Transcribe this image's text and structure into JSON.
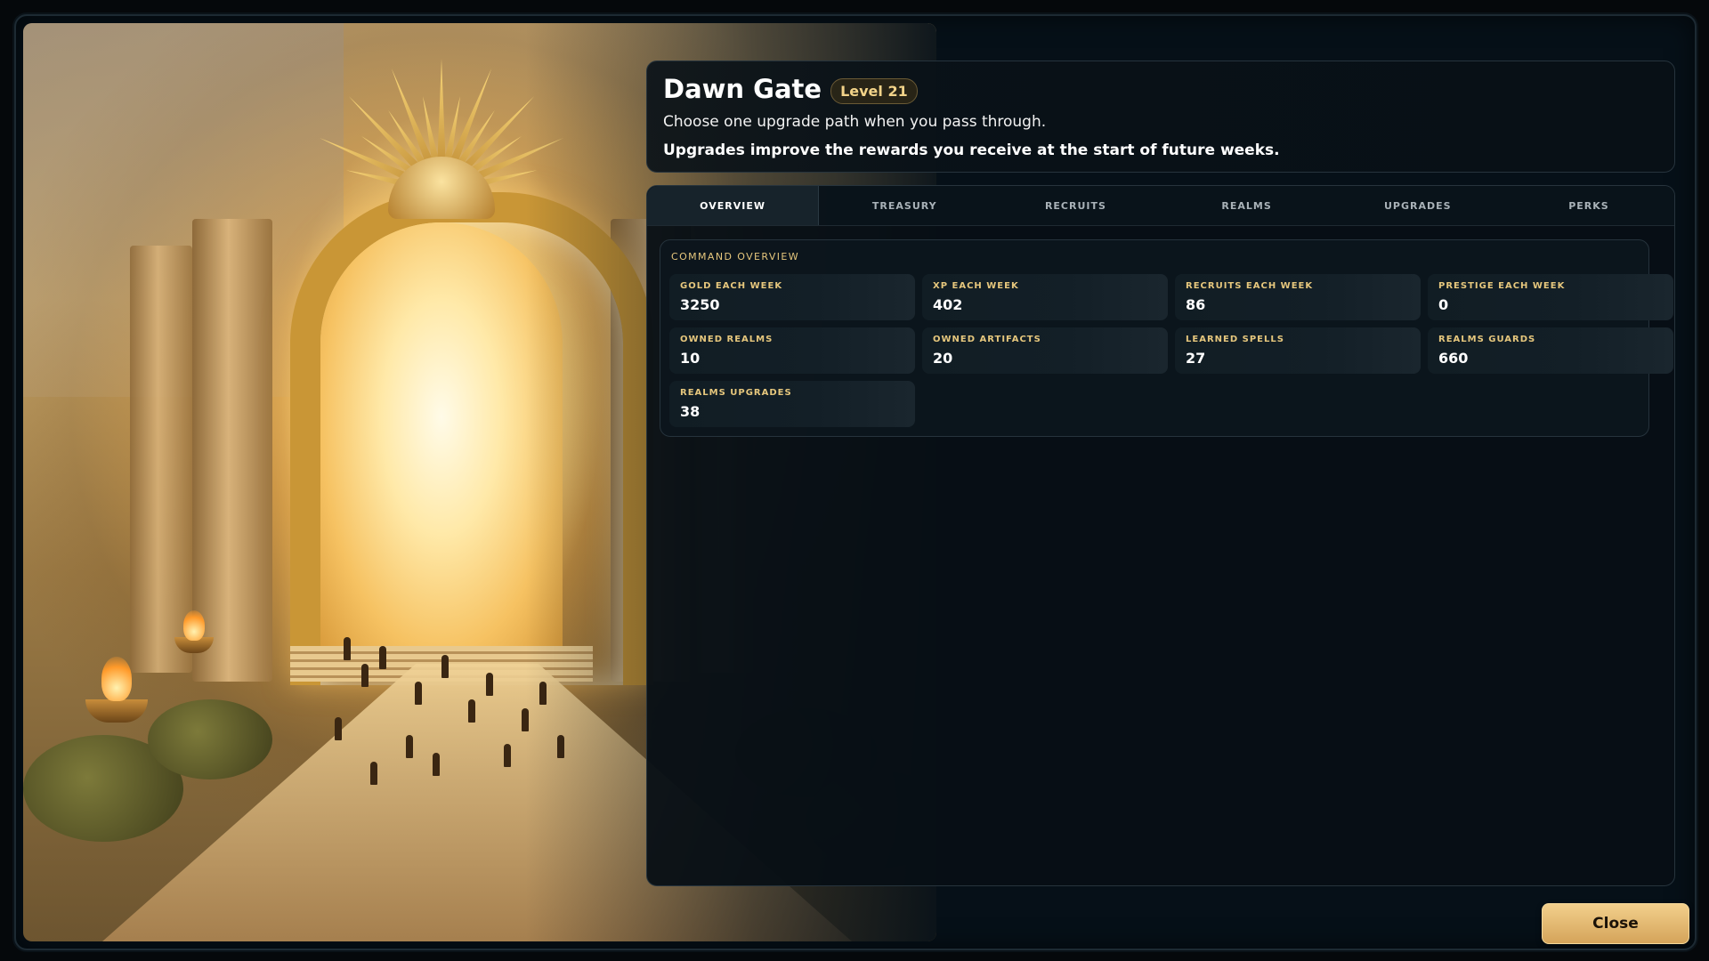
{
  "header": {
    "title": "Dawn Gate",
    "level_badge": "Level 21",
    "subtitle": "Choose one upgrade path when you pass through.",
    "description": "Upgrades improve the rewards you receive at the start of future weeks."
  },
  "tabs": [
    {
      "label": "OVERVIEW",
      "active": true
    },
    {
      "label": "TREASURY",
      "active": false
    },
    {
      "label": "RECRUITS",
      "active": false
    },
    {
      "label": "REALMS",
      "active": false
    },
    {
      "label": "UPGRADES",
      "active": false
    },
    {
      "label": "PERKS",
      "active": false
    }
  ],
  "overview": {
    "section_title": "COMMAND OVERVIEW",
    "stats": [
      {
        "label": "GOLD EACH WEEK",
        "value": "3250"
      },
      {
        "label": "XP EACH WEEK",
        "value": "402"
      },
      {
        "label": "RECRUITS EACH WEEK",
        "value": "86"
      },
      {
        "label": "PRESTIGE EACH WEEK",
        "value": "0"
      },
      {
        "label": "OWNED REALMS",
        "value": "10"
      },
      {
        "label": "OWNED ARTIFACTS",
        "value": "20"
      },
      {
        "label": "LEARNED SPELLS",
        "value": "27"
      },
      {
        "label": "REALMS GUARDS",
        "value": "660"
      },
      {
        "label": "REALMS UPGRADES",
        "value": "38"
      }
    ]
  },
  "footer": {
    "close_label": "Close"
  },
  "colors": {
    "accent_gold": "#e6c77d",
    "button_gold": "#f2cf8c",
    "panel_bg": "#0a141b"
  }
}
